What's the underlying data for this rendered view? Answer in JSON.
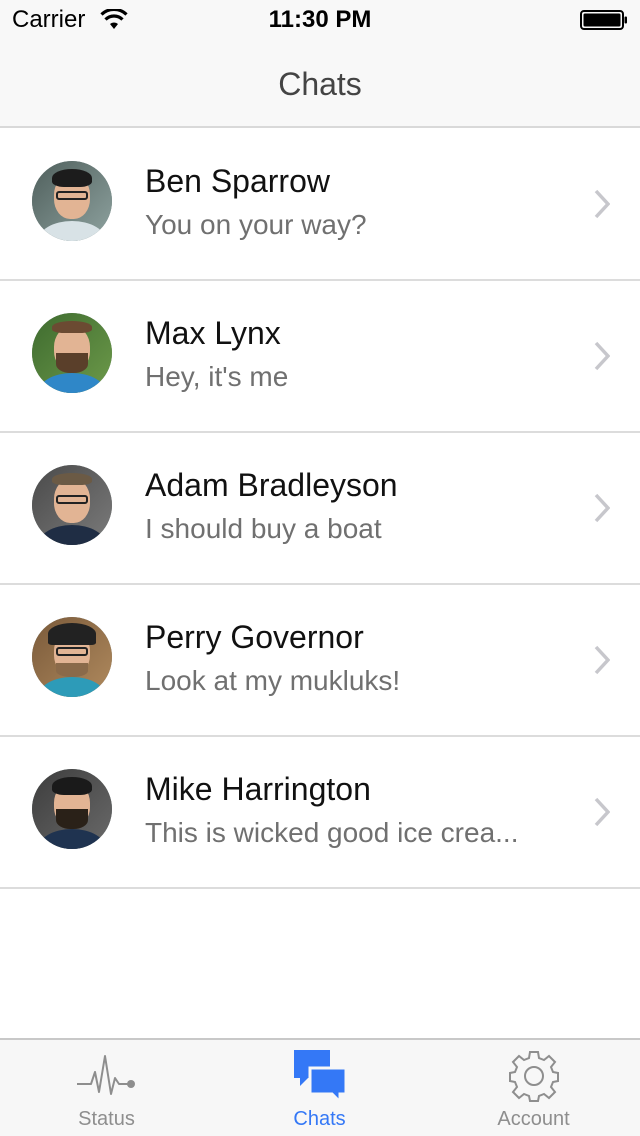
{
  "status_bar": {
    "carrier": "Carrier",
    "time": "11:30 PM",
    "wifi_icon": "wifi-icon",
    "battery_icon": "battery-icon"
  },
  "nav": {
    "title": "Chats"
  },
  "chats": [
    {
      "name": "Ben Sparrow",
      "preview": "You on your way?",
      "avatar": "avatar-ben-sparrow"
    },
    {
      "name": "Max Lynx",
      "preview": "Hey, it's me",
      "avatar": "avatar-max-lynx"
    },
    {
      "name": "Adam Bradleyson",
      "preview": "I should buy a boat",
      "avatar": "avatar-adam-bradleyson"
    },
    {
      "name": "Perry Governor",
      "preview": "Look at my mukluks!",
      "avatar": "avatar-perry-governor"
    },
    {
      "name": "Mike Harrington",
      "preview": "This is wicked good ice crea...",
      "avatar": "avatar-mike-harrington"
    }
  ],
  "tabs": [
    {
      "label": "Status",
      "icon": "pulse-icon",
      "active": false
    },
    {
      "label": "Chats",
      "icon": "chat-bubbles-icon",
      "active": true
    },
    {
      "label": "Account",
      "icon": "gear-icon",
      "active": false
    }
  ],
  "colors": {
    "accent": "#3478f6",
    "inactive_tab": "#8e8e8e",
    "preview_text": "#707070",
    "header_bg": "#f8f8f8"
  }
}
